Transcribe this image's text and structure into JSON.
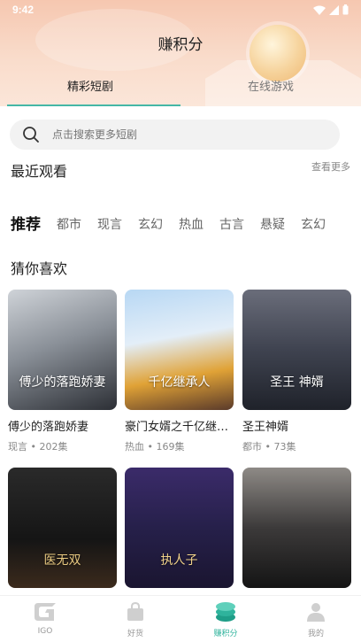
{
  "status_bar": {
    "time": "9:42"
  },
  "header": {
    "title": "赚积分"
  },
  "top_tabs": [
    {
      "label": "精彩短剧"
    },
    {
      "label": "在线游戏"
    }
  ],
  "search": {
    "placeholder": "点击搜索更多短剧"
  },
  "recent": {
    "title": "最近观看",
    "see_more": "查看更多"
  },
  "categories": [
    "推荐",
    "都市",
    "现言",
    "玄幻",
    "热血",
    "古言",
    "悬疑",
    "玄幻"
  ],
  "recommend": {
    "title": "猜你喜欢",
    "cards": [
      {
        "name": "傅少的落跑娇妻",
        "meta": "现言 • 202集",
        "overlay": "傅少的落跑娇妻"
      },
      {
        "name": "豪门女婿之千亿继承人",
        "meta": "热血 • 169集",
        "overlay": "千亿继承人"
      },
      {
        "name": "圣王神婿",
        "meta": "都市 • 73集",
        "overlay": "圣王 神婿"
      },
      {
        "name": "",
        "meta": "",
        "overlay": "医无双"
      },
      {
        "name": "",
        "meta": "",
        "overlay": "执人子"
      },
      {
        "name": "",
        "meta": "",
        "overlay": ""
      }
    ]
  },
  "bottom_nav": [
    {
      "label": "IGO",
      "icon": "igo-logo-icon"
    },
    {
      "label": "好货",
      "icon": "shopping-bag-icon"
    },
    {
      "label": "赚积分",
      "icon": "coin-stack-icon"
    },
    {
      "label": "我的",
      "icon": "user-icon"
    }
  ],
  "colors": {
    "accent": "#45b7a6",
    "active_underline": "#f3b23a",
    "nav_active": "#2fb39c"
  }
}
